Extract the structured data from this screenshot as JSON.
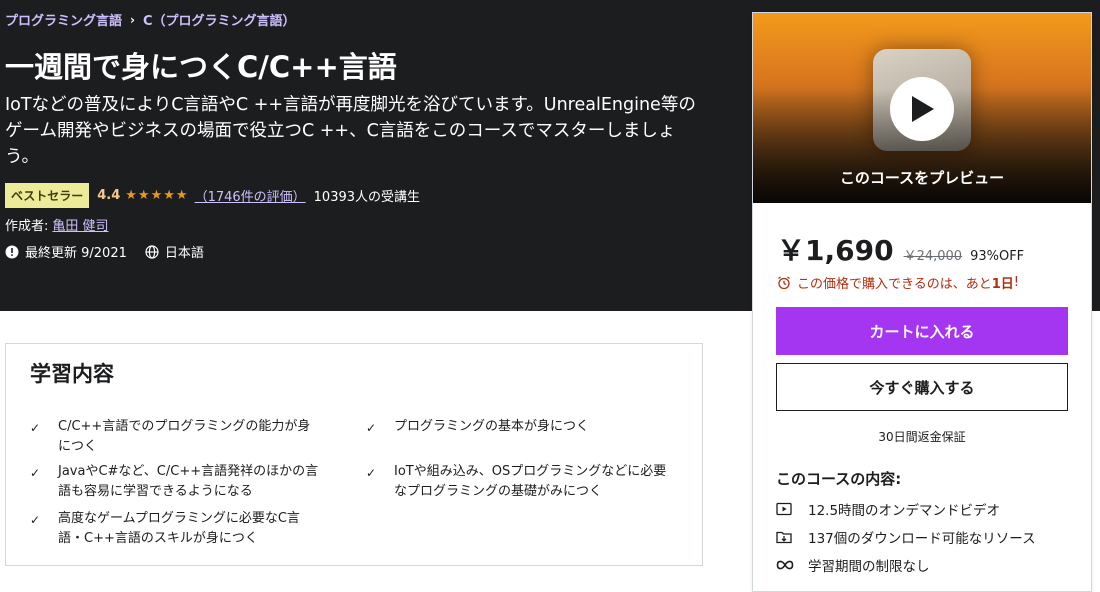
{
  "breadcrumb": {
    "items": [
      "プログラミング言語",
      "C（プログラミング言語）"
    ],
    "separator": "›"
  },
  "course": {
    "title": "一週間で身につくC/C++言語",
    "subtitle": "IoTなどの普及によりC言語やC ++言語が再度脚光を浴びています。UnrealEngine等のゲーム開発やビジネスの場面で役立つC ++、C言語をこのコースでマスターしましょう。",
    "badge": "ベストセラー",
    "rating": "4.4",
    "rating_value": 4.4,
    "stars": "★★★★★",
    "reviews": "（1746件の評価）",
    "students": "10393人の受講生",
    "author_label": "作成者:",
    "author_name": "亀田 健司",
    "updated": "最終更新 9/2021",
    "language": "日本語"
  },
  "learn": {
    "title": "学習内容",
    "items": [
      "C/C++言語でのプログラミングの能力が身につく",
      "プログラミングの基本が身につく",
      "JavaやC#など、C/C++言語発祥のほかの言語も容易に学習できるようになる",
      "IoTや組み込み、OSプログラミングなどに必要なプログラミングの基礎がみにつく",
      "高度なゲームプログラミングに必要なC言語・C++言語のスキルが身につく"
    ]
  },
  "sidebar": {
    "preview_label": "このコースをプレビュー",
    "price": "￥1,690",
    "original_price": "￥24,000",
    "discount": "93%OFF",
    "timer_text": "この価格で購入できるのは、あと",
    "timer_days": "1日",
    "timer_suffix": "!",
    "cart_button": "カートに入れる",
    "buy_button": "今すぐ購入する",
    "guarantee": "30日間返金保証",
    "includes_title": "このコースの内容:",
    "includes": [
      {
        "icon": "video-icon",
        "text": "12.5時間のオンデマンドビデオ"
      },
      {
        "icon": "file-download-icon",
        "text": "137個のダウンロード可能なリソース"
      },
      {
        "icon": "infinity-icon",
        "text": "学習期間の制限なし"
      }
    ]
  },
  "colors": {
    "hero_bg": "#1c1d1f",
    "accent_purple": "#a435f0",
    "link_purple": "#cec0fc",
    "badge_bg": "#eceb98",
    "star_color": "#e59819",
    "timer_red": "#b32d0f"
  }
}
